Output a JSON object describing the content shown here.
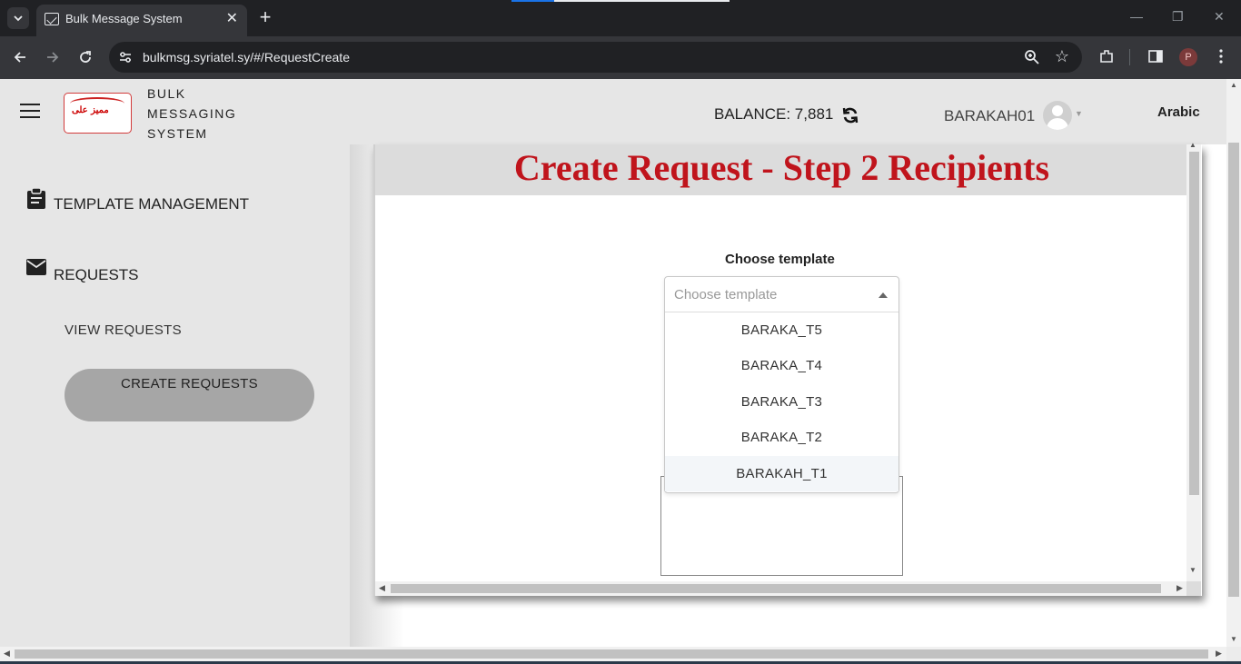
{
  "browser": {
    "tab_title": "Bulk Message System",
    "tab_close": "✕",
    "new_tab": "+",
    "url": "bulkmsg.syriatel.sy/#/RequestCreate",
    "profile_initial": "P",
    "window_controls": [
      "—",
      "❐",
      "✕"
    ]
  },
  "header": {
    "brand_lines": [
      "BULK",
      "MESSAGING",
      "SYSTEM"
    ],
    "logo_text": "ممیز علی",
    "balance_label": "BALANCE: 7,881",
    "username": "BARAKAH01",
    "language": "Arabic"
  },
  "sidebar": {
    "items": [
      {
        "label": "TEMPLATE MANAGEMENT",
        "icon": "clipboard-icon"
      },
      {
        "label": "REQUESTS",
        "icon": "envelope-icon"
      }
    ],
    "sub_items": [
      {
        "label": "VIEW REQUESTS"
      },
      {
        "label": "CREATE REQUESTS",
        "active": true
      }
    ]
  },
  "main": {
    "page_title": "Create Request - Step 2 Recipients",
    "choose_label": "Choose template",
    "select": {
      "placeholder": "Choose template",
      "options": [
        "BARAKA_T5",
        "BARAKA_T4",
        "BARAKA_T3",
        "BARAKA_T2",
        "BARAKAH_T1"
      ],
      "highlighted_index": 4
    }
  },
  "colors": {
    "title_red": "#c0141c",
    "sidebar_bg": "#e6e6e6",
    "active_pill": "#a6a6a6",
    "chrome_dark": "#202124"
  }
}
